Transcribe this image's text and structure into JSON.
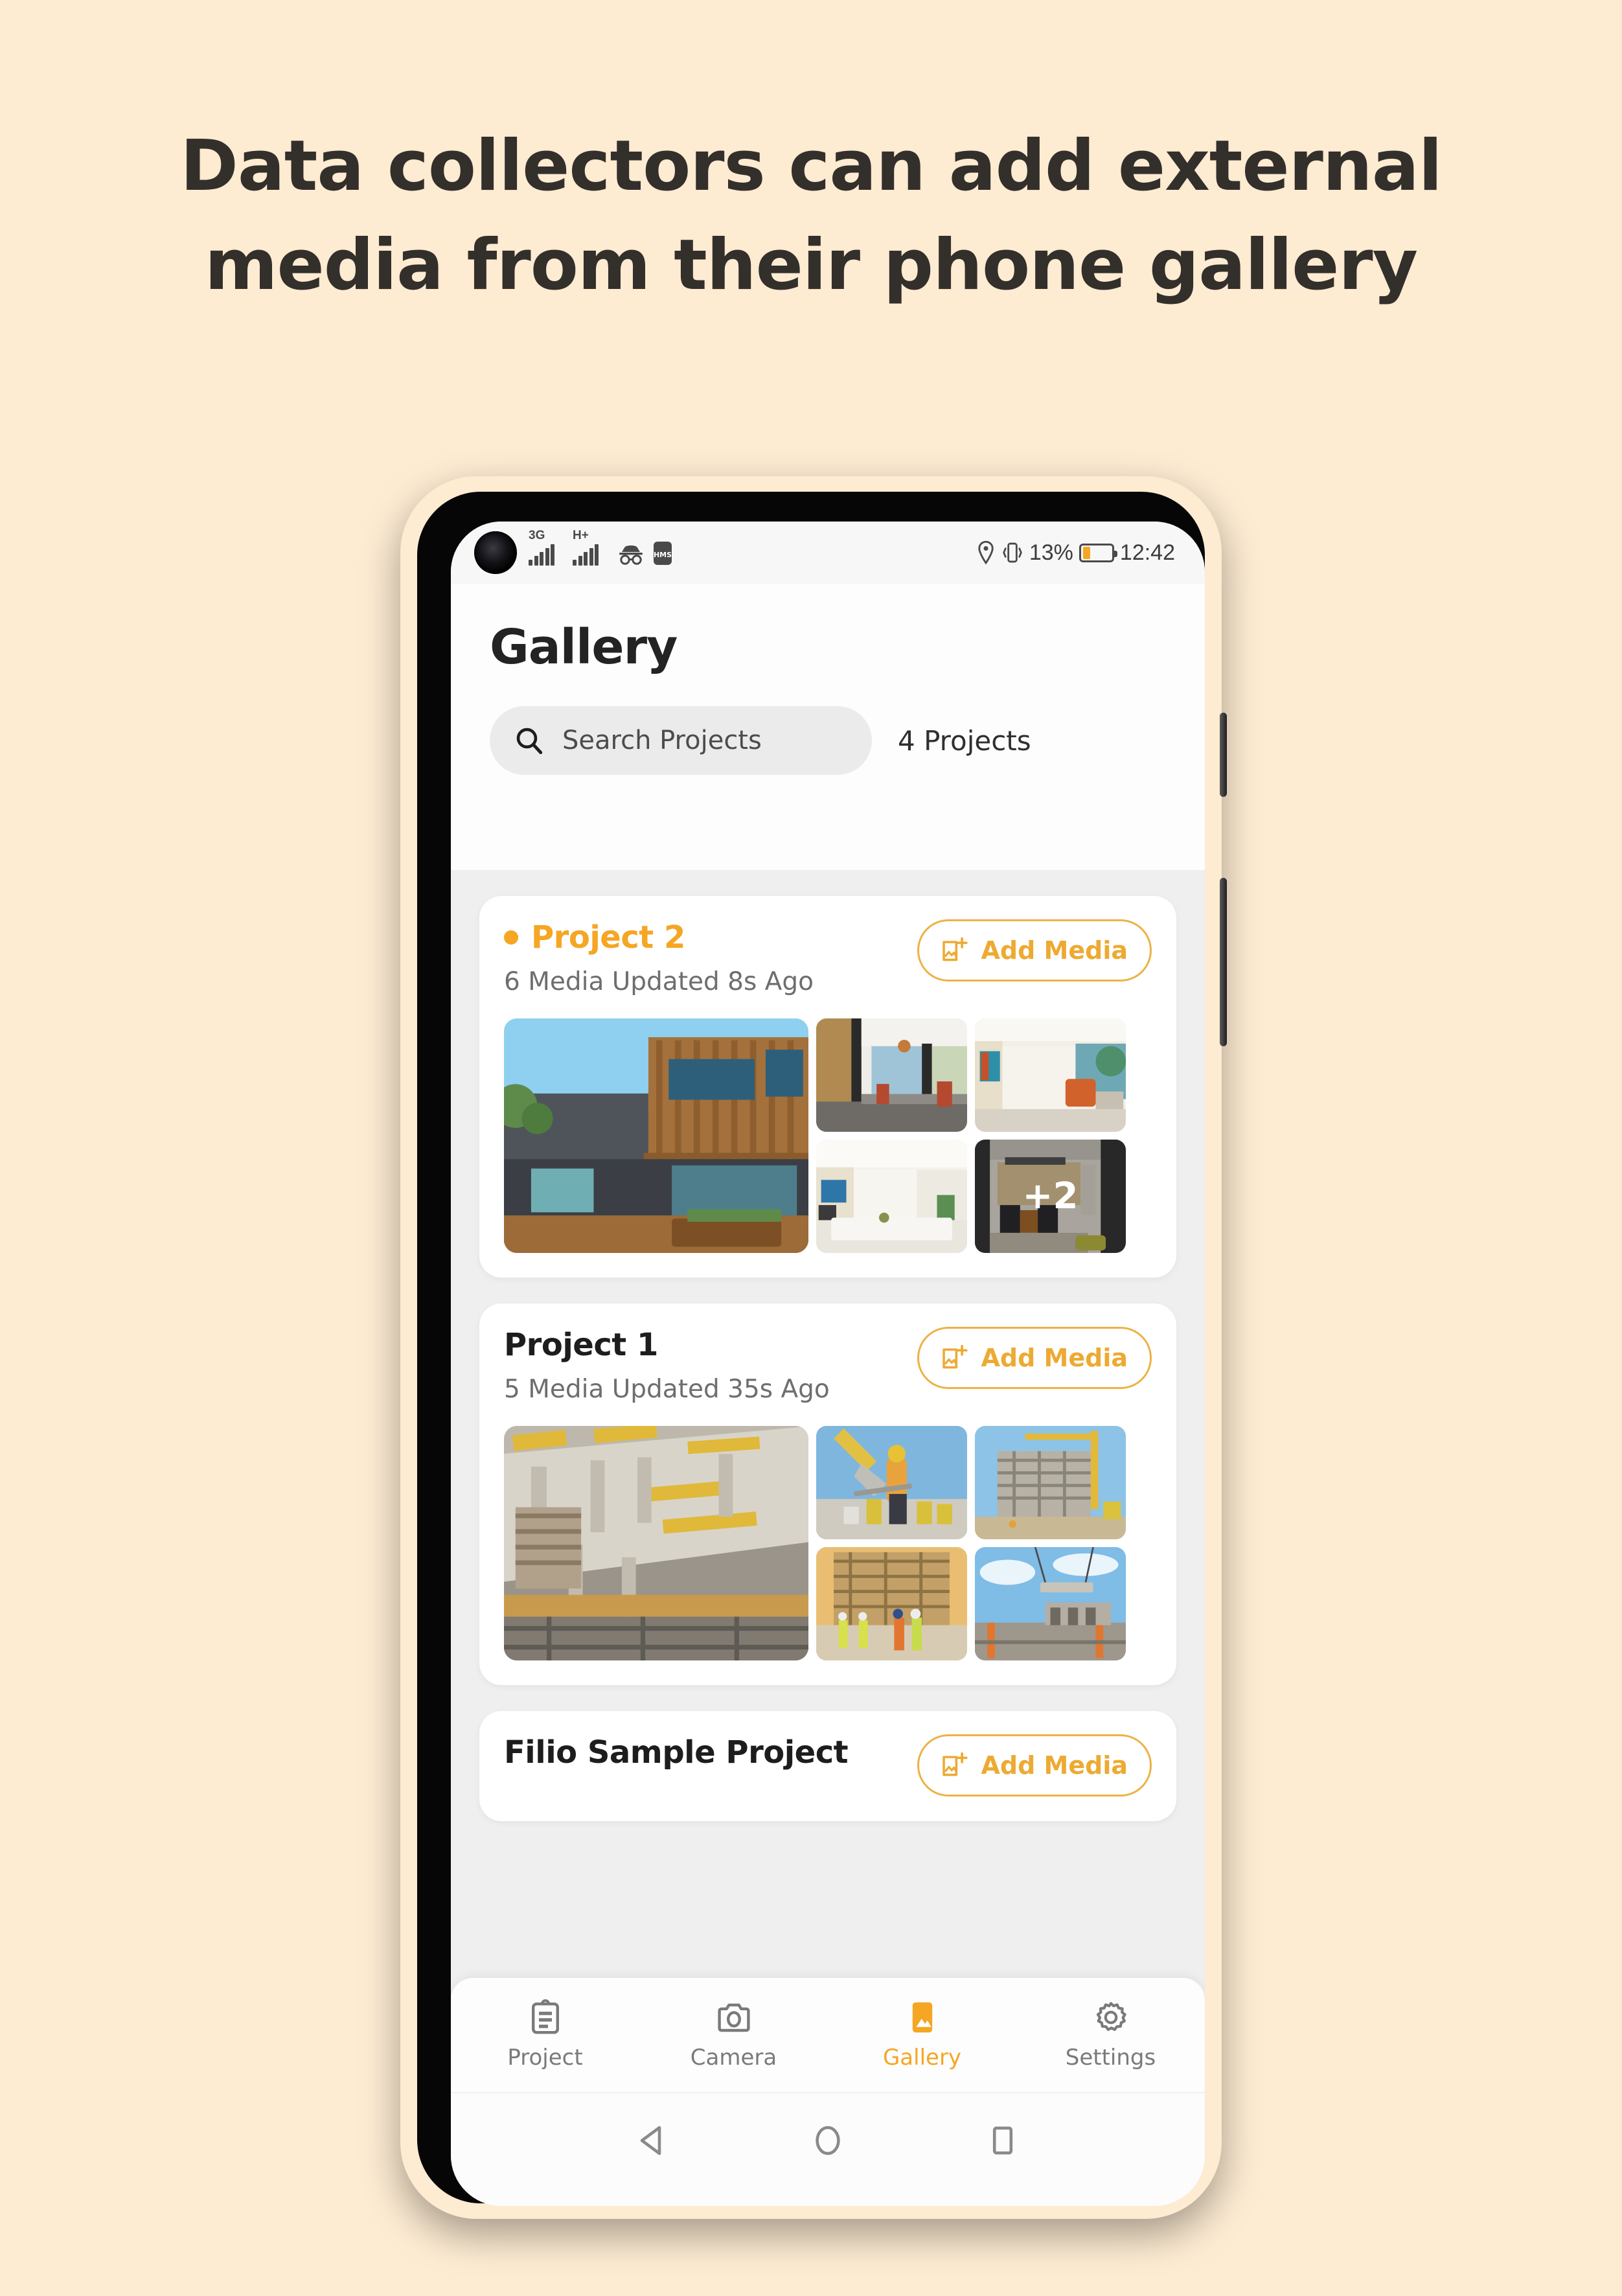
{
  "headline": {
    "line1": "Data collectors can add external",
    "line2": "media from their phone gallery"
  },
  "colors": {
    "page_background": "#FDEBD2",
    "accent": "#F5A623",
    "screen_background": "#EFEFEF",
    "card_background": "#FFFFFF",
    "heading_text": "#332F2B"
  },
  "status_bar": {
    "network_3g_label": "3G",
    "network_h_label": "H+",
    "battery_percent": "13%",
    "time": "12:42",
    "hms_label": "HMS"
  },
  "header": {
    "title": "Gallery"
  },
  "search": {
    "placeholder": "Search Projects",
    "count_label": "4 Projects"
  },
  "projects": [
    {
      "name": "Project 2",
      "active": true,
      "subtitle": "6 Media Updated 8s Ago",
      "add_media_label": "Add Media",
      "more_count": "+2"
    },
    {
      "name": "Project 1",
      "active": false,
      "subtitle": "5 Media Updated 35s Ago",
      "add_media_label": "Add Media",
      "more_count": ""
    },
    {
      "name": "Filio Sample Project",
      "active": false,
      "subtitle": "",
      "add_media_label": "Add Media",
      "more_count": ""
    }
  ],
  "bottom_nav": {
    "items": [
      {
        "label": "Project",
        "icon": "clipboard-icon",
        "active": false
      },
      {
        "label": "Camera",
        "icon": "camera-icon",
        "active": false
      },
      {
        "label": "Gallery",
        "icon": "image-icon",
        "active": true
      },
      {
        "label": "Settings",
        "icon": "gear-icon",
        "active": false
      }
    ]
  },
  "system_nav": {
    "back": "back-triangle-icon",
    "home": "home-circle-icon",
    "recents": "recents-square-icon"
  }
}
